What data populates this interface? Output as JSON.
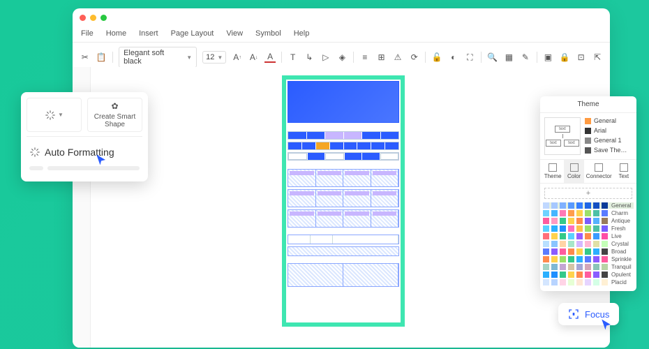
{
  "window": {
    "traffic": {
      "red": "#ff5f57",
      "yellow": "#febc2e",
      "green": "#28c840"
    }
  },
  "menubar": [
    "File",
    "Home",
    "Insert",
    "Page Layout",
    "View",
    "Symbol",
    "Help"
  ],
  "toolbar": {
    "font": "Elegant soft black",
    "size": "12"
  },
  "popover": {
    "create_smart_shape": "Create Smart Shape",
    "auto_formatting": "Auto Formatting"
  },
  "theme_panel": {
    "title": "Theme",
    "preview_labels": [
      "text",
      "text",
      "text"
    ],
    "categories": [
      {
        "label": "General",
        "color": "#ff9b42"
      },
      {
        "label": "Arial",
        "color": "#333333"
      },
      {
        "label": "General 1",
        "color": "#888888"
      },
      {
        "label": "Save The…",
        "color": "#555555"
      }
    ],
    "tabs": [
      "Theme",
      "Color",
      "Connector",
      "Text"
    ],
    "active_tab": 1,
    "add": "+",
    "palettes": [
      {
        "name": "General",
        "colors": [
          "#c0d8ff",
          "#a6c8ff",
          "#7fb1ff",
          "#589aff",
          "#367fff",
          "#1f66e6",
          "#134fc2",
          "#0a3b99"
        ]
      },
      {
        "name": "Charm",
        "colors": [
          "#6fd3ff",
          "#46b6ff",
          "#ff7ab6",
          "#ff9d4d",
          "#ffd24d",
          "#9ce06a",
          "#4cc0a6",
          "#5a7bff"
        ]
      },
      {
        "name": "Antique",
        "colors": [
          "#ff5c9e",
          "#ff9bc2",
          "#34c98a",
          "#ffd24d",
          "#ff8a4d",
          "#7a5cff",
          "#55b2ff",
          "#9a7b5a"
        ]
      },
      {
        "name": "Fresh",
        "colors": [
          "#5ad1ff",
          "#2bb0ff",
          "#1f8fff",
          "#ff6fbf",
          "#ffc14d",
          "#9ce06a",
          "#4cc0a6",
          "#7a5cff"
        ]
      },
      {
        "name": "Live",
        "colors": [
          "#ff6f7a",
          "#ffd24d",
          "#34c98a",
          "#5ad1ff",
          "#9a5cff",
          "#ff8a4d",
          "#3a9bff",
          "#ff4da6"
        ]
      },
      {
        "name": "Crystal",
        "colors": [
          "#b8e0ff",
          "#8ac4ff",
          "#ffd4a6",
          "#a6e6c9",
          "#d4b8ff",
          "#ffb8d4",
          "#e0e0a6",
          "#c4ffb8"
        ]
      },
      {
        "name": "Broad",
        "colors": [
          "#5a7bff",
          "#8a5cff",
          "#ff5c9e",
          "#ff8a4d",
          "#ffd24d",
          "#34c98a",
          "#2bb0ff",
          "#444444"
        ]
      },
      {
        "name": "Sprinkle",
        "colors": [
          "#ff8a4d",
          "#ffd24d",
          "#9ce06a",
          "#34c98a",
          "#2bb0ff",
          "#5a7bff",
          "#8a5cff",
          "#ff5c9e"
        ]
      },
      {
        "name": "Tranquil",
        "colors": [
          "#a6d4c4",
          "#7fb8d4",
          "#c4a6d4",
          "#d4c4a6",
          "#a6a6d4",
          "#d4a6b8",
          "#8ac4b8",
          "#b8d4a6"
        ]
      },
      {
        "name": "Opulent",
        "colors": [
          "#2bb0ff",
          "#1f8fff",
          "#34c98a",
          "#ffd24d",
          "#ff8a4d",
          "#ff5c9e",
          "#8a5cff",
          "#444444"
        ]
      },
      {
        "name": "Placid",
        "colors": [
          "#d4e6ff",
          "#b8d4ff",
          "#ffd4e6",
          "#e6ffd4",
          "#ffe6d4",
          "#e6d4ff",
          "#d4ffe6",
          "#fff0d4"
        ]
      }
    ],
    "active_palette": 0
  },
  "focus": {
    "label": "Focus"
  }
}
